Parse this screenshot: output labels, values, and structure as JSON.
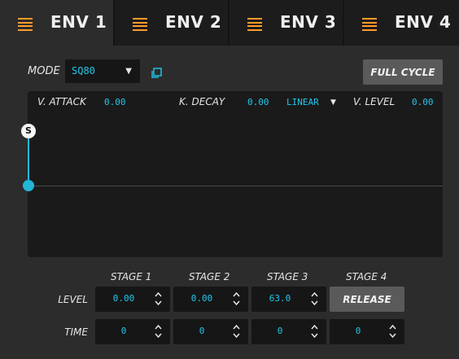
{
  "tabs": [
    {
      "label": "ENV 1",
      "active": true
    },
    {
      "label": "ENV 2",
      "active": false
    },
    {
      "label": "ENV 3",
      "active": false
    },
    {
      "label": "ENV 4",
      "active": false
    }
  ],
  "mode": {
    "label": "MODE",
    "value": "SQ80"
  },
  "full_cycle_label": "FULL CYCLE",
  "graph": {
    "v_attack_label": "V. ATTACK",
    "v_attack_value": "0.00",
    "k_decay_label": "K. DECAY",
    "k_decay_value": "0.00",
    "curve_value": "LINEAR",
    "v_level_label": "V. LEVEL",
    "v_level_value": "0.00",
    "sustain_handle": "S"
  },
  "stages": {
    "headers": [
      "STAGE 1",
      "STAGE 2",
      "STAGE 3",
      "STAGE 4"
    ],
    "level_label": "LEVEL",
    "time_label": "TIME",
    "level": [
      "0.00",
      "0.00",
      "63.0"
    ],
    "release_label": "RELEASE",
    "time": [
      "0",
      "0",
      "0",
      "0"
    ]
  },
  "colors": {
    "accent_orange": "#ff9a2a",
    "value_cyan": "#22c7ea",
    "background": "#2c2c2c"
  }
}
